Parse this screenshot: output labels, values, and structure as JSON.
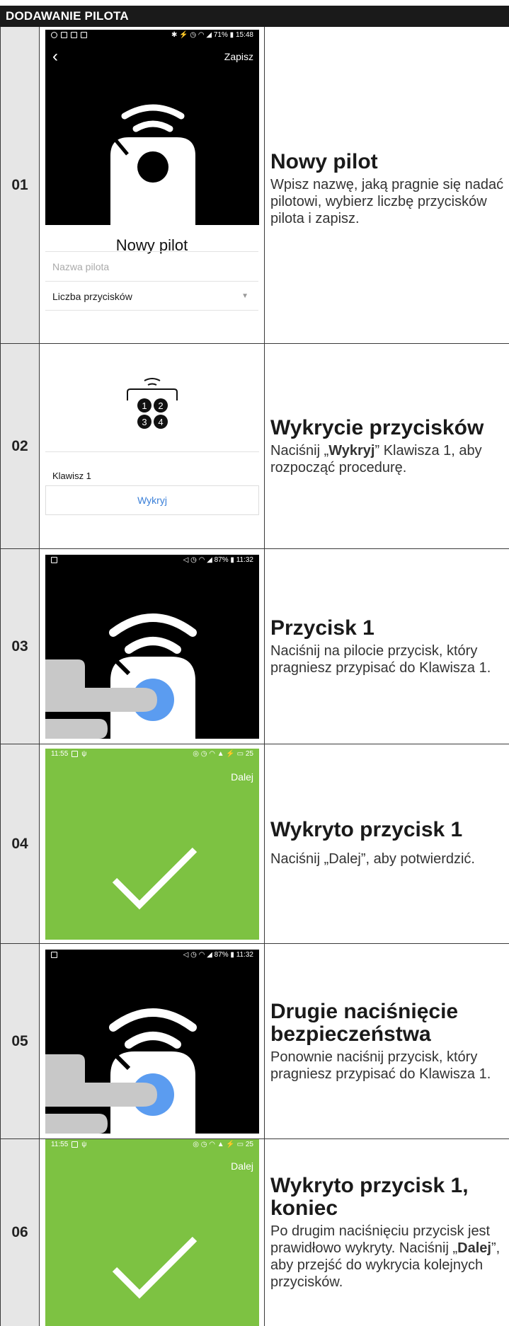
{
  "header": {
    "title": "DODAWANIE PILOTA"
  },
  "steps": [
    {
      "num": "01",
      "title": "Nowy pilot",
      "desc": "Wpisz nazwę, jaką pragnie się nadać pilotowi, wybierz liczbę przycisków pilota i zapisz.",
      "screen": {
        "time": "15:48",
        "battery": "71%",
        "save_label": "Zapisz",
        "form_title": "Nowy pilot",
        "name_placeholder": "Nazwa pilota",
        "buttons_count_label": "Liczba przycisków"
      }
    },
    {
      "num": "02",
      "title": "Wykrycie przycisków",
      "desc_pre": "Naciśnij „",
      "desc_bold": "Wykryj",
      "desc_post": "” Klawisza 1, aby rozpocząć procedurę.",
      "screen": {
        "keys": [
          "1",
          "2",
          "3",
          "4"
        ],
        "key_label": "Klawisz 1",
        "detect_label": "Wykryj"
      }
    },
    {
      "num": "03",
      "title": "Przycisk 1",
      "desc": "Naciśnij na pilocie przycisk, który pragniesz przypisać do Klawisza 1.",
      "screen": {
        "time": "11:32",
        "battery": "87%"
      }
    },
    {
      "num": "04",
      "title": "Wykryto przycisk 1",
      "desc": "Naciśnij „Dalej”, aby potwierdzić.",
      "screen": {
        "time": "11:55",
        "battery": "25",
        "next_label": "Dalej"
      }
    },
    {
      "num": "05",
      "title": "Drugie naciśnięcie bezpieczeństwa",
      "desc": "Ponownie naciśnij przycisk, który pragniesz przypisać do Klawisza 1.",
      "screen": {
        "time": "11:32",
        "battery": "87%"
      }
    },
    {
      "num": "06",
      "title": "Wykryto przycisk 1, koniec",
      "desc_pre": "Po drugim naciśnięciu przycisk jest prawidłowo wykryty. Naciśnij „",
      "desc_bold": "Dalej",
      "desc_post": "”, aby przejść do wykrycia kolejnych przycisków.",
      "screen": {
        "time": "11:55",
        "battery": "25",
        "next_label": "Dalej"
      }
    }
  ],
  "colors": {
    "header_bg": "#1a1a1a",
    "num_col_bg": "#e6e6e6",
    "screen_green": "#7dc242",
    "accent_blue": "#5b9cf0",
    "link_blue": "#3a7fd8"
  }
}
